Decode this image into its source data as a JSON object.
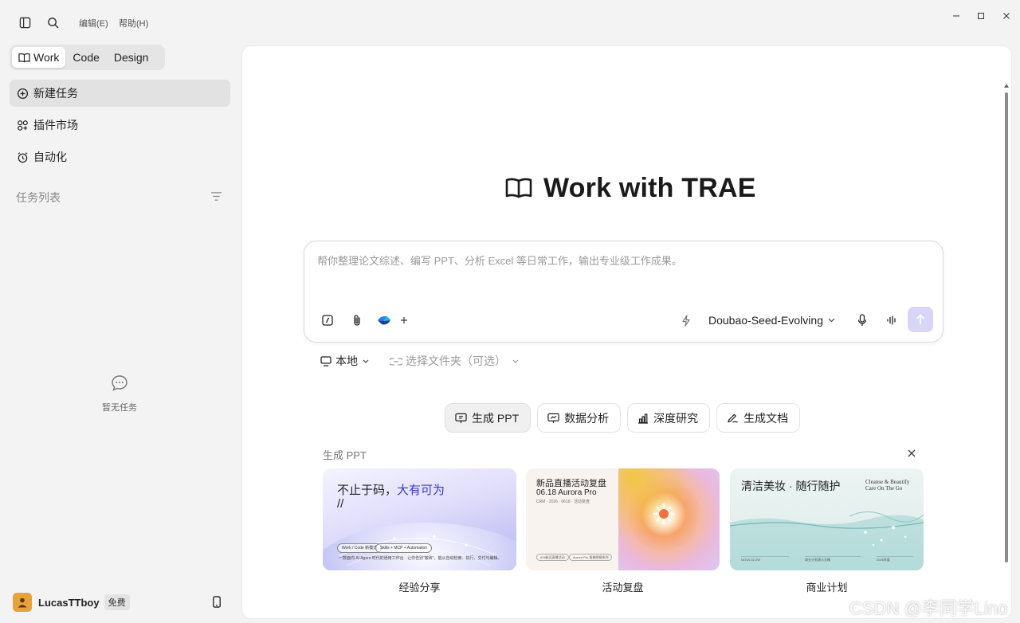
{
  "topbar": {
    "menu_edit": "编辑(E)",
    "menu_help": "帮助(H)"
  },
  "sidebar": {
    "modes": [
      "Work",
      "Code",
      "Design"
    ],
    "active_mode": "Work",
    "nav": [
      {
        "label": "新建任务",
        "icon": "plus-circle-icon",
        "active": true
      },
      {
        "label": "插件市场",
        "icon": "plugins-grid-icon",
        "active": false
      },
      {
        "label": "自动化",
        "icon": "alarm-clock-icon",
        "active": false
      }
    ],
    "task_list_title": "任务列表",
    "empty_text": "暂无任务",
    "user": {
      "name": "LucasTTboy",
      "plan": "免费"
    }
  },
  "main": {
    "title": "Work with TRAE",
    "input_placeholder": "帮你整理论文综述、编写 PPT、分析 Excel 等日常工作，输出专业级工作成果。",
    "model": "Doubao-Seed-Evolving",
    "location": "本地",
    "folder_placeholder": "选择文件夹（可选）",
    "chips": [
      {
        "label": "生成 PPT",
        "icon": "presentation-icon",
        "active": true
      },
      {
        "label": "数据分析",
        "icon": "presentation-chart-icon",
        "active": false
      },
      {
        "label": "深度研究",
        "icon": "bar-chart-icon",
        "active": false
      },
      {
        "label": "生成文档",
        "icon": "pen-doc-icon",
        "active": false
      }
    ],
    "section_title": "生成 PPT",
    "cards": [
      {
        "caption": "经验分享",
        "title_main": "不止于码，",
        "title_accent": "大有可为",
        "title_slash": "//",
        "tags": [
          "Work / Code 新模式",
          "Skills + MCP + Automation"
        ],
        "small_text": "一款面向 AI Agent 时代的通用工作台 · 让你告别“搬砖”，能从自动检索、执行、交付与编辑。"
      },
      {
        "caption": "活动复盘",
        "title_line1": "新品直播活动复盘",
        "title_line2": "06.18 Aurora Pro",
        "title_line3": "CRM · 2026 · 0618 · 活动复盘",
        "tags": [
          "618新品直播活动",
          "Aurora Pro 智能眼镜系列"
        ]
      },
      {
        "caption": "商业计划",
        "title_cn": "清洁美妆 · 随行随护",
        "title_en_1": "Cleanse & Beautify",
        "title_en_2": "Care On The Go",
        "footer": [
          "NOVA GLOW",
          "商业计划演示文稿",
          "2026年度"
        ]
      }
    ]
  },
  "watermark": "CSDN @李同学Lino",
  "colors": {
    "accent": "#3d36d6",
    "send_button": "#d8d6f6",
    "avatar": "#e8a23d"
  }
}
